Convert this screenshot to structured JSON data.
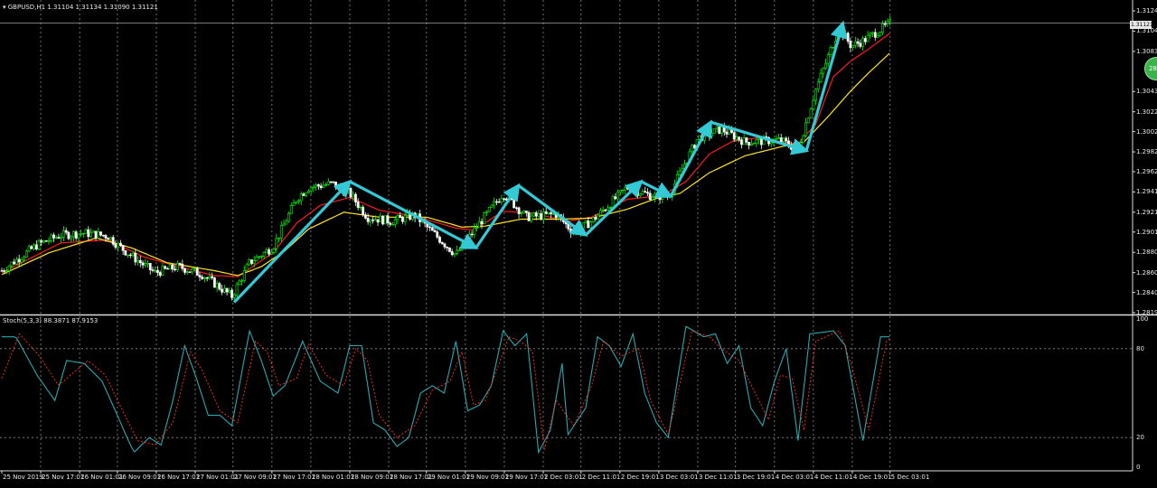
{
  "colors": {
    "background": "#000000",
    "bull_candle": "#00ff00",
    "bear_candle": "#ffffff",
    "ma_fast": "#ff1a1a",
    "ma_slow": "#ffe526",
    "annotation_arrow": "#34c9d6",
    "stoch_main": "#2aa8b0",
    "stoch_signal": "#ff3030",
    "grid": "#8a8a8a"
  },
  "chart_data": [
    {
      "type": "candlestick",
      "title": "GBPUSD,H1  1.31104 1.31134 1.31090 1.31121",
      "symbol": "GBPUSD",
      "timeframe": "H1",
      "ohlc_current": {
        "open": 1.31104,
        "high": 1.31134,
        "low": 1.3109,
        "close": 1.31121
      },
      "current_price": "1.31121",
      "ylim": [
        1.28195,
        1.31245
      ],
      "y_ticks": [
        "1.31245",
        "1.31040",
        "1.30835",
        "1.30430",
        "1.30225",
        "1.30025",
        "1.29820",
        "1.29620",
        "1.29415",
        "1.29210",
        "1.29010",
        "1.28805",
        "1.28600",
        "1.28400",
        "1.28195"
      ],
      "x_ticks": [
        "25 Nov 2019",
        "25 Nov 17:01",
        "26 Nov 01:01",
        "26 Nov 09:01",
        "26 Nov 17:01",
        "27 Nov 01:01",
        "27 Nov 09:01",
        "27 Nov 17:01",
        "28 Nov 01:01",
        "28 Nov 09:01",
        "28 Nov 17:01",
        "29 Nov 01:01",
        "29 Nov 09:01",
        "29 Nov 17:01",
        "2 Dec 03:01",
        "2 Dec 11:01",
        "2 Dec 19:01",
        "3 Dec 03:01",
        "3 Dec 11:01",
        "3 Dec 19:01",
        "4 Dec 03:01",
        "4 Dec 11:01",
        "4 Dec 19:01",
        "5 Dec 03:01"
      ],
      "x_tick_positions": [
        0,
        3.3,
        6.6,
        9.8,
        13.1,
        16.4,
        19.6,
        22.9,
        26.2,
        29.5,
        32.8,
        36.0,
        39.3,
        42.6,
        45.9,
        49.1,
        52.4,
        55.7,
        59.0,
        62.2,
        65.5,
        68.8,
        72.1,
        75.3
      ],
      "grid": true,
      "close_anchors": [
        [
          0,
          1.2862
        ],
        [
          3,
          1.2888
        ],
        [
          5,
          1.2898
        ],
        [
          7,
          1.29
        ],
        [
          9,
          1.2897
        ],
        [
          10,
          1.2886
        ],
        [
          12,
          1.2868
        ],
        [
          13,
          1.286
        ],
        [
          15,
          1.2866
        ],
        [
          17,
          1.2858
        ],
        [
          19.5,
          1.2836
        ],
        [
          21,
          1.287
        ],
        [
          23,
          1.2886
        ],
        [
          25,
          1.2935
        ],
        [
          26,
          1.2946
        ],
        [
          28,
          1.295
        ],
        [
          29.5,
          1.294
        ],
        [
          31,
          1.2916
        ],
        [
          33,
          1.2912
        ],
        [
          35,
          1.2918
        ],
        [
          38.5,
          1.2878
        ],
        [
          40.5,
          1.291
        ],
        [
          42.5,
          1.294
        ],
        [
          44.5,
          1.2916
        ],
        [
          47,
          1.2919
        ],
        [
          48.5,
          1.29
        ],
        [
          50,
          1.2912
        ],
        [
          53,
          1.2946
        ],
        [
          55,
          1.2938
        ],
        [
          56.5,
          1.2937
        ],
        [
          59,
          1.2996
        ],
        [
          61,
          1.3005
        ],
        [
          63,
          1.2992
        ],
        [
          66,
          1.2994
        ],
        [
          67.5,
          1.2984
        ],
        [
          69,
          1.3045
        ],
        [
          71,
          1.3108
        ],
        [
          72,
          1.3089
        ],
        [
          73,
          1.3094
        ],
        [
          75.3,
          1.3112
        ]
      ],
      "series": [
        {
          "name": "",
          "role": "ma_fast",
          "anchors": [
            [
              0,
              1.286
            ],
            [
              5,
              1.289
            ],
            [
              9,
              1.2893
            ],
            [
              12,
              1.2876
            ],
            [
              15,
              1.2866
            ],
            [
              18,
              1.2857
            ],
            [
              20,
              1.2856
            ],
            [
              23,
              1.288
            ],
            [
              25,
              1.291
            ],
            [
              27,
              1.2928
            ],
            [
              29.5,
              1.2936
            ],
            [
              32,
              1.2923
            ],
            [
              35,
              1.2917
            ],
            [
              38.5,
              1.2905
            ],
            [
              40,
              1.2903
            ],
            [
              42.5,
              1.2922
            ],
            [
              45,
              1.292
            ],
            [
              48,
              1.2912
            ],
            [
              50,
              1.2916
            ],
            [
              53,
              1.2934
            ],
            [
              56,
              1.2938
            ],
            [
              58,
              1.2952
            ],
            [
              60,
              1.298
            ],
            [
              62,
              1.2993
            ],
            [
              64,
              1.2996
            ],
            [
              67.5,
              1.299
            ],
            [
              69,
              1.301
            ],
            [
              70.5,
              1.3058
            ],
            [
              72,
              1.3074
            ],
            [
              73.5,
              1.3086
            ],
            [
              75.3,
              1.3102
            ]
          ]
        },
        {
          "name": "",
          "role": "ma_slow",
          "anchors": [
            [
              0,
              1.2858
            ],
            [
              4,
              1.288
            ],
            [
              8,
              1.2895
            ],
            [
              11,
              1.2885
            ],
            [
              14,
              1.287
            ],
            [
              18,
              1.2862
            ],
            [
              20,
              1.2857
            ],
            [
              22,
              1.2866
            ],
            [
              24,
              1.2882
            ],
            [
              26,
              1.2904
            ],
            [
              29,
              1.2921
            ],
            [
              32,
              1.2916
            ],
            [
              36,
              1.2916
            ],
            [
              39,
              1.2906
            ],
            [
              41,
              1.2907
            ],
            [
              44,
              1.2914
            ],
            [
              47,
              1.2914
            ],
            [
              50,
              1.2915
            ],
            [
              53,
              1.2924
            ],
            [
              55.5,
              1.2935
            ],
            [
              57.5,
              1.294
            ],
            [
              60,
              1.2961
            ],
            [
              63,
              1.2978
            ],
            [
              66,
              1.2987
            ],
            [
              68,
              1.2992
            ],
            [
              70,
              1.3017
            ],
            [
              72,
              1.3044
            ],
            [
              73.5,
              1.3062
            ],
            [
              75.3,
              1.3082
            ]
          ]
        }
      ],
      "arrows": [
        [
          [
            19.7,
            1.283
          ],
          [
            29.5,
            1.2952
          ]
        ],
        [
          [
            29.5,
            1.2952
          ],
          [
            40.2,
            1.2885
          ]
        ],
        [
          [
            40.2,
            1.2885
          ],
          [
            43.8,
            1.2948
          ]
        ],
        [
          [
            43.8,
            1.2948
          ],
          [
            49.5,
            1.2898
          ]
        ],
        [
          [
            49.5,
            1.2898
          ],
          [
            54.2,
            1.2952
          ]
        ],
        [
          [
            54.2,
            1.2952
          ],
          [
            56.7,
            1.2937
          ]
        ],
        [
          [
            56.7,
            1.2937
          ],
          [
            60.1,
            1.3012
          ]
        ],
        [
          [
            60.1,
            1.3012
          ],
          [
            68.2,
            1.2983
          ]
        ],
        [
          [
            68.2,
            1.2983
          ],
          [
            71.3,
            1.3112
          ]
        ]
      ]
    },
    {
      "type": "line",
      "title": "Stoch(5,3,3) 88.3871 87.9153",
      "indicator": "Stochastic Oscillator",
      "params": "5,3,3",
      "main_value": 88.3871,
      "signal_value": 87.9153,
      "ylim": [
        0,
        100
      ],
      "y_ticks": [
        "100",
        "80",
        "20",
        "0"
      ],
      "levels": [
        80,
        20
      ],
      "series": [
        {
          "name": "",
          "role": "main",
          "anchors": [
            [
              0,
              88
            ],
            [
              1.2,
              88
            ],
            [
              3,
              62
            ],
            [
              4.5,
              45
            ],
            [
              5.5,
              72
            ],
            [
              7,
              70
            ],
            [
              8.5,
              58
            ],
            [
              9.8,
              35
            ],
            [
              10.5,
              22
            ],
            [
              11.2,
              10
            ],
            [
              12.5,
              20
            ],
            [
              13.5,
              15
            ],
            [
              14.5,
              45
            ],
            [
              15.5,
              82
            ],
            [
              16.5,
              60
            ],
            [
              17.5,
              35
            ],
            [
              18.5,
              35
            ],
            [
              19.5,
              28
            ],
            [
              21,
              92
            ],
            [
              22,
              72
            ],
            [
              23,
              48
            ],
            [
              24,
              55
            ],
            [
              25.5,
              85
            ],
            [
              27,
              58
            ],
            [
              28.5,
              50
            ],
            [
              29.5,
              82
            ],
            [
              30.5,
              82
            ],
            [
              31.5,
              30
            ],
            [
              32.5,
              25
            ],
            [
              33.5,
              14
            ],
            [
              34.5,
              20
            ],
            [
              35.5,
              50
            ],
            [
              36.5,
              55
            ],
            [
              37.5,
              50
            ],
            [
              38.5,
              85
            ],
            [
              39.5,
              38
            ],
            [
              40.5,
              42
            ],
            [
              41.5,
              55
            ],
            [
              42.5,
              92
            ],
            [
              43.5,
              82
            ],
            [
              44.5,
              90
            ],
            [
              45.5,
              10
            ],
            [
              46.5,
              25
            ],
            [
              47.5,
              70
            ],
            [
              48,
              22
            ],
            [
              49.5,
              40
            ],
            [
              50.5,
              88
            ],
            [
              51.5,
              82
            ],
            [
              52.5,
              68
            ],
            [
              53.5,
              90
            ],
            [
              54.5,
              50
            ],
            [
              55.5,
              30
            ],
            [
              56.5,
              20
            ],
            [
              58,
              95
            ],
            [
              59.5,
              88
            ],
            [
              60.5,
              90
            ],
            [
              61.5,
              70
            ],
            [
              62.5,
              82
            ],
            [
              63.5,
              40
            ],
            [
              64.5,
              28
            ],
            [
              65.5,
              58
            ],
            [
              66.5,
              80
            ],
            [
              67.5,
              18
            ],
            [
              68.5,
              90
            ],
            [
              70.5,
              92
            ],
            [
              71.5,
              82
            ],
            [
              73,
              18
            ],
            [
              74.5,
              88
            ],
            [
              75.3,
              88
            ]
          ]
        },
        {
          "name": "",
          "role": "signal",
          "anchors": [
            [
              0,
              60
            ],
            [
              1.5,
              90
            ],
            [
              3.2,
              75
            ],
            [
              4.8,
              55
            ],
            [
              5.8,
              62
            ],
            [
              7.3,
              72
            ],
            [
              8.8,
              62
            ],
            [
              10,
              42
            ],
            [
              11.5,
              18
            ],
            [
              13,
              15
            ],
            [
              14.5,
              30
            ],
            [
              16,
              78
            ],
            [
              17,
              65
            ],
            [
              18.5,
              38
            ],
            [
              20,
              30
            ],
            [
              21.5,
              85
            ],
            [
              22.5,
              78
            ],
            [
              23.5,
              55
            ],
            [
              25,
              60
            ],
            [
              26,
              83
            ],
            [
              27.5,
              62
            ],
            [
              29,
              55
            ],
            [
              30,
              80
            ],
            [
              31,
              72
            ],
            [
              32,
              35
            ],
            [
              33.5,
              20
            ],
            [
              35,
              28
            ],
            [
              36.5,
              52
            ],
            [
              38,
              58
            ],
            [
              39,
              78
            ],
            [
              40,
              42
            ],
            [
              41,
              45
            ],
            [
              43,
              88
            ],
            [
              44,
              85
            ],
            [
              45,
              78
            ],
            [
              46,
              12
            ],
            [
              47,
              45
            ],
            [
              48.5,
              28
            ],
            [
              50,
              55
            ],
            [
              51,
              85
            ],
            [
              52.5,
              75
            ],
            [
              54,
              80
            ],
            [
              55,
              45
            ],
            [
              56.5,
              22
            ],
            [
              58.5,
              92
            ],
            [
              60,
              88
            ],
            [
              61,
              80
            ],
            [
              62.5,
              72
            ],
            [
              64,
              48
            ],
            [
              65,
              32
            ],
            [
              66,
              62
            ],
            [
              67,
              60
            ],
            [
              68,
              25
            ],
            [
              69,
              85
            ],
            [
              71,
              92
            ],
            [
              72,
              70
            ],
            [
              73.5,
              25
            ],
            [
              75,
              85
            ],
            [
              75.3,
              87
            ]
          ]
        }
      ]
    }
  ]
}
